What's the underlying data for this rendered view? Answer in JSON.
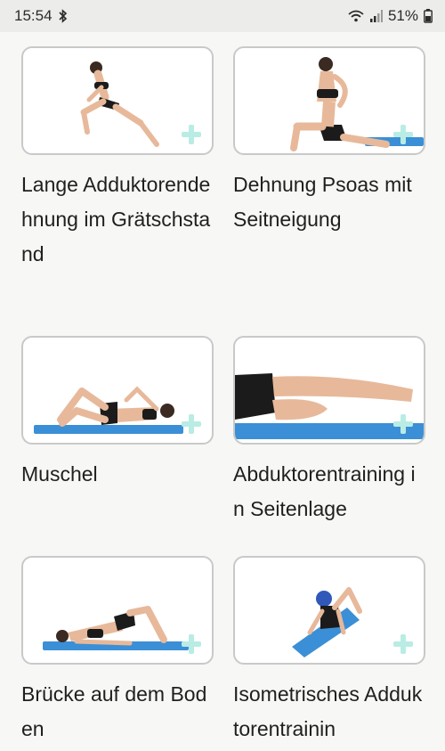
{
  "status_bar": {
    "time": "15:54",
    "battery": "51%",
    "icons": [
      "bluetooth-icon",
      "wifi-icon",
      "signal-icon",
      "battery-icon"
    ]
  },
  "exercises": [
    {
      "title": "Lange Adduktorendehnung im Grätschstand",
      "image": "exercise-image-adductor-stretch"
    },
    {
      "title": "Dehnung Psoas mit Seitneigung",
      "image": "exercise-image-psoas-stretch"
    },
    {
      "title": "Muschel",
      "image": "exercise-image-clamshell"
    },
    {
      "title": "Abduktorentraining in Seitenlage",
      "image": "exercise-image-side-lying-abduction"
    },
    {
      "title": "Brücke auf dem Boden",
      "image": "exercise-image-floor-bridge"
    },
    {
      "title": "Isometrisches Adduktorentrainin",
      "image": "exercise-image-isometric-adductor"
    }
  ],
  "colors": {
    "mat_blue": "#3b8fd6",
    "plus_mint": "#b9ece4",
    "skin": "#e7b99a",
    "clothing": "#1b1b1b"
  }
}
